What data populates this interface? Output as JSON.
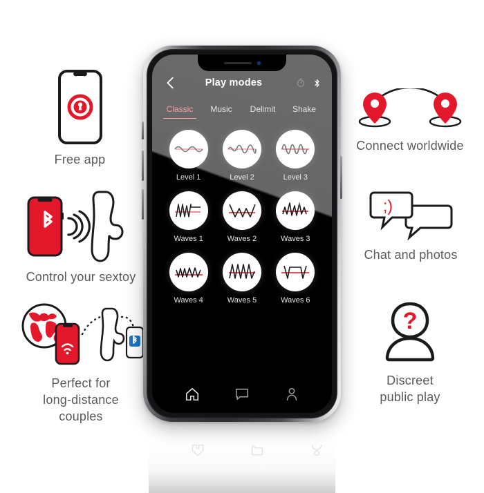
{
  "brand": {
    "red": "#e3192b",
    "accent_pink": "#f4606a",
    "caption_gray": "#58595b",
    "blue": "#1a73c8"
  },
  "phone": {
    "header": {
      "back_icon": "chevron-left-icon",
      "title": "Play modes",
      "timer_icon": "timer-icon",
      "bluetooth_icon": "bluetooth-icon"
    },
    "tabs": [
      {
        "label": "Classic",
        "active": true
      },
      {
        "label": "Music",
        "active": false
      },
      {
        "label": "Delimit",
        "active": false
      },
      {
        "label": "Shake",
        "active": false
      }
    ],
    "modes": [
      {
        "label": "Level 1",
        "icon": "wave-level-1-icon"
      },
      {
        "label": "Level 2",
        "icon": "wave-level-2-icon"
      },
      {
        "label": "Level 3",
        "icon": "wave-level-3-icon"
      },
      {
        "label": "Waves 1",
        "icon": "wave-waves-1-icon"
      },
      {
        "label": "Waves 2",
        "icon": "wave-waves-2-icon"
      },
      {
        "label": "Waves 3",
        "icon": "wave-waves-3-icon"
      },
      {
        "label": "Waves 4",
        "icon": "wave-waves-4-icon"
      },
      {
        "label": "Waves 5",
        "icon": "wave-waves-5-icon"
      },
      {
        "label": "Waves 6",
        "icon": "wave-waves-6-icon"
      }
    ],
    "tabbar": [
      {
        "icon": "home-icon",
        "name": "home"
      },
      {
        "icon": "chat-bubble-icon",
        "name": "chat"
      },
      {
        "icon": "person-icon",
        "name": "profile"
      }
    ]
  },
  "features": {
    "free_app": {
      "caption": "Free app",
      "icon": "phone-with-lock-badge-icon"
    },
    "control": {
      "caption": "Control your sextoy",
      "icon": "phone-bluetooth-toy-icon"
    },
    "distance": {
      "caption": "Perfect for\nlong-distance\ncouples",
      "icon": "globe-phone-toy-icon"
    },
    "connect": {
      "caption": "Connect worldwide",
      "icon": "two-map-pins-icon"
    },
    "chat": {
      "caption": "Chat and photos",
      "icon": "speech-bubbles-icon",
      "emoticon": ";)"
    },
    "discreet": {
      "caption": "Discreet\npublic play",
      "icon": "anonymous-person-icon",
      "mark": "?"
    }
  }
}
